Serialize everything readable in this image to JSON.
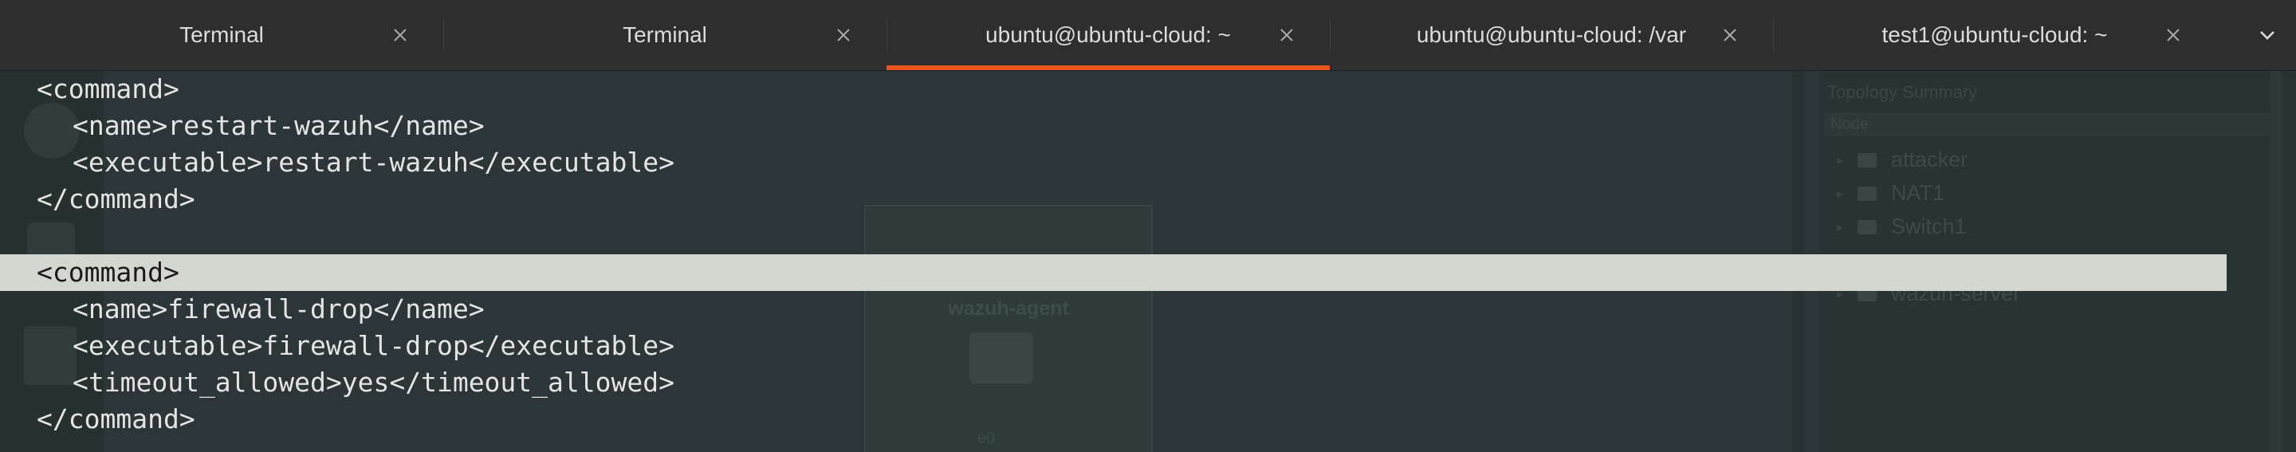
{
  "tabs": [
    {
      "title": "Terminal",
      "active": false
    },
    {
      "title": "Terminal",
      "active": false
    },
    {
      "title": "ubuntu@ubuntu-cloud: ~",
      "active": true
    },
    {
      "title": "ubuntu@ubuntu-cloud: /var",
      "active": false
    },
    {
      "title": "test1@ubuntu-cloud: ~",
      "active": false
    }
  ],
  "accent_color": "#e95420",
  "highlight_color": "#d3d7cf",
  "terminal": {
    "lines": [
      "<command>",
      "<name>restart-wazuh</name>",
      "<executable>restart-wazuh</executable>",
      "</command>",
      "",
      "<command>",
      "<name>firewall-drop</name>",
      "<executable>firewall-drop</executable>",
      "<timeout_allowed>yes</timeout_allowed>",
      "</command>"
    ]
  },
  "background": {
    "card_label": "wazuh-agent",
    "card_ip": "e0",
    "panel_title": "Topology Summary",
    "panel_header": "Node",
    "panel_nodes": [
      "attacker",
      "NAT1",
      "Switch1",
      "wazuh-server"
    ]
  },
  "icons": {
    "tab_close": "close-icon",
    "tab_menu": "chevron-down-icon"
  }
}
